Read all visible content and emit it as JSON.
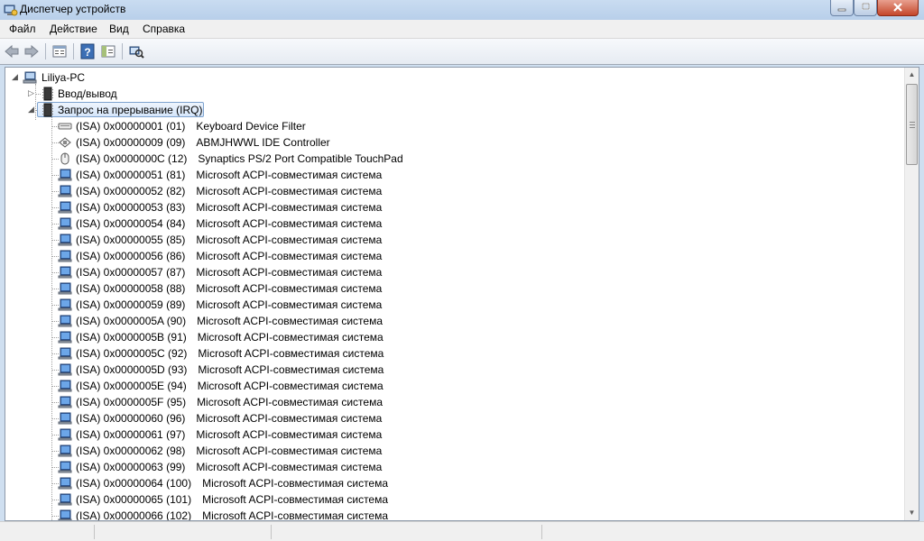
{
  "window": {
    "title": "Диспетчер устройств",
    "icons": {
      "app": "device-manager-icon",
      "minimize": "minimize-icon",
      "maximize": "maximize-icon",
      "close": "close-icon"
    }
  },
  "menu": [
    "Файл",
    "Действие",
    "Вид",
    "Справка"
  ],
  "toolbar": [
    "back-arrow-icon",
    "forward-arrow-icon",
    "properties-icon",
    "help-icon",
    "show-hide-icon",
    "scan-hardware-icon"
  ],
  "tree": {
    "root": "Liliya-PC",
    "categories": [
      {
        "label": "Ввод/вывод",
        "expanded": false
      },
      {
        "label": "Запрос на прерывание (IRQ)",
        "expanded": true
      }
    ],
    "irq_items": [
      {
        "res": "(ISA) 0x00000001 (01)",
        "device": "Keyboard Device Filter",
        "icon": "keyboard-icon"
      },
      {
        "res": "(ISA) 0x00000009 (09)",
        "device": "ABMJHWWL IDE Controller",
        "icon": "ide-controller-icon"
      },
      {
        "res": "(ISA) 0x0000000C (12)",
        "device": "Synaptics PS/2 Port Compatible TouchPad",
        "icon": "mouse-icon"
      },
      {
        "res": "(ISA) 0x00000051 (81)",
        "device": "Microsoft ACPI-совместимая система",
        "icon": "computer-icon"
      },
      {
        "res": "(ISA) 0x00000052 (82)",
        "device": "Microsoft ACPI-совместимая система",
        "icon": "computer-icon"
      },
      {
        "res": "(ISA) 0x00000053 (83)",
        "device": "Microsoft ACPI-совместимая система",
        "icon": "computer-icon"
      },
      {
        "res": "(ISA) 0x00000054 (84)",
        "device": "Microsoft ACPI-совместимая система",
        "icon": "computer-icon"
      },
      {
        "res": "(ISA) 0x00000055 (85)",
        "device": "Microsoft ACPI-совместимая система",
        "icon": "computer-icon"
      },
      {
        "res": "(ISA) 0x00000056 (86)",
        "device": "Microsoft ACPI-совместимая система",
        "icon": "computer-icon"
      },
      {
        "res": "(ISA) 0x00000057 (87)",
        "device": "Microsoft ACPI-совместимая система",
        "icon": "computer-icon"
      },
      {
        "res": "(ISA) 0x00000058 (88)",
        "device": "Microsoft ACPI-совместимая система",
        "icon": "computer-icon"
      },
      {
        "res": "(ISA) 0x00000059 (89)",
        "device": "Microsoft ACPI-совместимая система",
        "icon": "computer-icon"
      },
      {
        "res": "(ISA) 0x0000005A (90)",
        "device": "Microsoft ACPI-совместимая система",
        "icon": "computer-icon"
      },
      {
        "res": "(ISA) 0x0000005B (91)",
        "device": "Microsoft ACPI-совместимая система",
        "icon": "computer-icon"
      },
      {
        "res": "(ISA) 0x0000005C (92)",
        "device": "Microsoft ACPI-совместимая система",
        "icon": "computer-icon"
      },
      {
        "res": "(ISA) 0x0000005D (93)",
        "device": "Microsoft ACPI-совместимая система",
        "icon": "computer-icon"
      },
      {
        "res": "(ISA) 0x0000005E (94)",
        "device": "Microsoft ACPI-совместимая система",
        "icon": "computer-icon"
      },
      {
        "res": "(ISA) 0x0000005F (95)",
        "device": "Microsoft ACPI-совместимая система",
        "icon": "computer-icon"
      },
      {
        "res": "(ISA) 0x00000060 (96)",
        "device": "Microsoft ACPI-совместимая система",
        "icon": "computer-icon"
      },
      {
        "res": "(ISA) 0x00000061 (97)",
        "device": "Microsoft ACPI-совместимая система",
        "icon": "computer-icon"
      },
      {
        "res": "(ISA) 0x00000062 (98)",
        "device": "Microsoft ACPI-совместимая система",
        "icon": "computer-icon"
      },
      {
        "res": "(ISA) 0x00000063 (99)",
        "device": "Microsoft ACPI-совместимая система",
        "icon": "computer-icon"
      },
      {
        "res": "(ISA) 0x00000064 (100)",
        "device": "Microsoft ACPI-совместимая система",
        "icon": "computer-icon"
      },
      {
        "res": "(ISA) 0x00000065 (101)",
        "device": "Microsoft ACPI-совместимая система",
        "icon": "computer-icon"
      },
      {
        "res": "(ISA) 0x00000066 (102)",
        "device": "Microsoft ACPI-совместимая система",
        "icon": "computer-icon"
      }
    ]
  },
  "colors": {
    "selection_border": "#7da2ce",
    "title_bar": "#c9dcf1",
    "close_button": "#c4462a"
  }
}
